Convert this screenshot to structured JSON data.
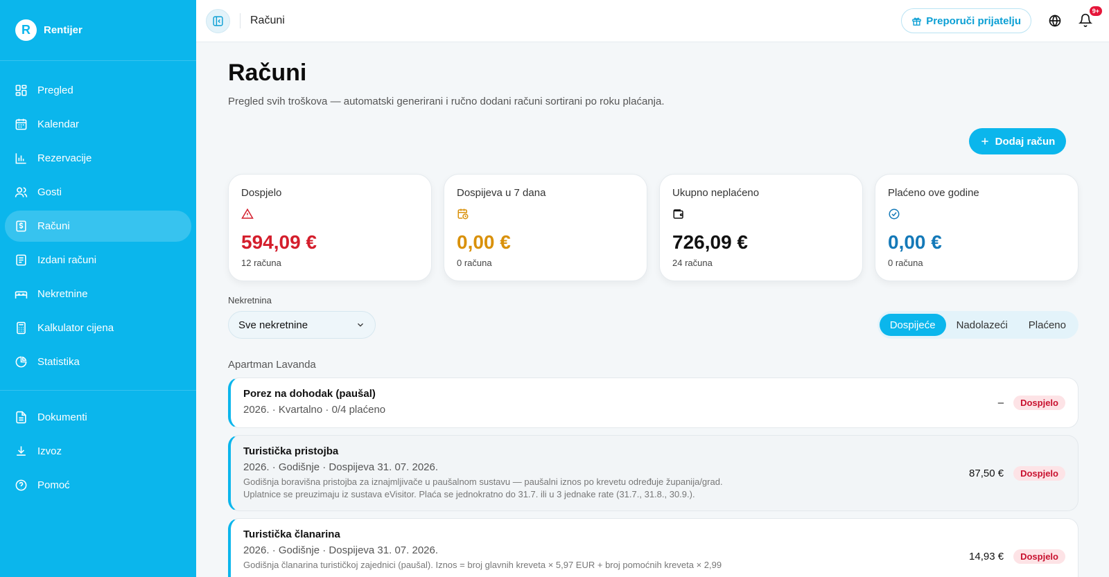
{
  "brand": {
    "logo_letter": "R",
    "name": "Rentijer"
  },
  "sidebar": {
    "items": [
      {
        "label": "Pregled",
        "icon": "dashboard-icon"
      },
      {
        "label": "Kalendar",
        "icon": "calendar-icon"
      },
      {
        "label": "Rezervacije",
        "icon": "bar-chart-icon"
      },
      {
        "label": "Gosti",
        "icon": "users-icon"
      },
      {
        "label": "Računi",
        "icon": "dollar-receipt-icon",
        "active": true
      },
      {
        "label": "Izdani računi",
        "icon": "document-list-icon"
      },
      {
        "label": "Nekretnine",
        "icon": "bed-icon"
      },
      {
        "label": "Kalkulator cijena",
        "icon": "calculator-icon"
      },
      {
        "label": "Statistika",
        "icon": "pie-chart-icon"
      }
    ],
    "bottom_items": [
      {
        "label": "Dokumenti",
        "icon": "file-icon"
      },
      {
        "label": "Izvoz",
        "icon": "download-icon"
      },
      {
        "label": "Pomoć",
        "icon": "help-circle-icon"
      }
    ]
  },
  "topbar": {
    "title": "Računi",
    "refer_label": "Preporuči prijatelju",
    "notification_badge": "9+"
  },
  "page": {
    "title": "Računi",
    "subtitle": "Pregled svih troškova — automatski generirani i ručno dodani računi sortirani po roku plaćanja.",
    "add_button": "Dodaj račun"
  },
  "stats": [
    {
      "label": "Dospjelo",
      "value": "594,09 €",
      "count": "12 računa",
      "color": "#d41e2c",
      "icon": "warning-triangle-icon"
    },
    {
      "label": "Dospijeva u 7 dana",
      "value": "0,00 €",
      "count": "0 računa",
      "color": "#d9910b",
      "icon": "calendar-clock-icon"
    },
    {
      "label": "Ukupno neplaćeno",
      "value": "726,09 €",
      "count": "24 računa",
      "color": "#111111",
      "icon": "wallet-icon"
    },
    {
      "label": "Plaćeno ove godine",
      "value": "0,00 €",
      "count": "0 računa",
      "color": "#1479b8",
      "icon": "check-circle-icon"
    }
  ],
  "filter": {
    "label": "Nekretnina",
    "selected": "Sve nekretnine"
  },
  "tabs": [
    {
      "label": "Dospijeće",
      "active": true
    },
    {
      "label": "Nadolazeći",
      "active": false
    },
    {
      "label": "Plaćeno",
      "active": false
    }
  ],
  "group": {
    "title": "Apartman Lavanda"
  },
  "bills": [
    {
      "name": "Porez na dohodak (paušal)",
      "meta": "2026. · Kvartalno · 0/4 plaćeno",
      "desc": "",
      "desc2": "",
      "amount": "–",
      "status": "Dospjelo"
    },
    {
      "name": "Turistička pristojba",
      "meta": "2026. · Godišnje · Dospijeva 31. 07. 2026.",
      "desc": "Godišnja boravišna pristojba za iznajmljivače u paušalnom sustavu — paušalni iznos po krevetu određuje županija/grad.",
      "desc2": "Uplatnice se preuzimaju iz sustava eVisitor. Plaća se jednokratno do 31.7. ili u 3 jednake rate (31.7., 31.8., 30.9.).",
      "amount": "87,50 €",
      "status": "Dospjelo"
    },
    {
      "name": "Turistička članarina",
      "meta": "2026. · Godišnje · Dospijeva 31. 07. 2026.",
      "desc": "Godišnja članarina turističkoj zajednici (paušal). Iznos = broj glavnih kreveta × 5,97 EUR + broj pomoćnih kreveta × 2,99",
      "desc2": "",
      "amount": "14,93 €",
      "status": "Dospjelo"
    }
  ]
}
